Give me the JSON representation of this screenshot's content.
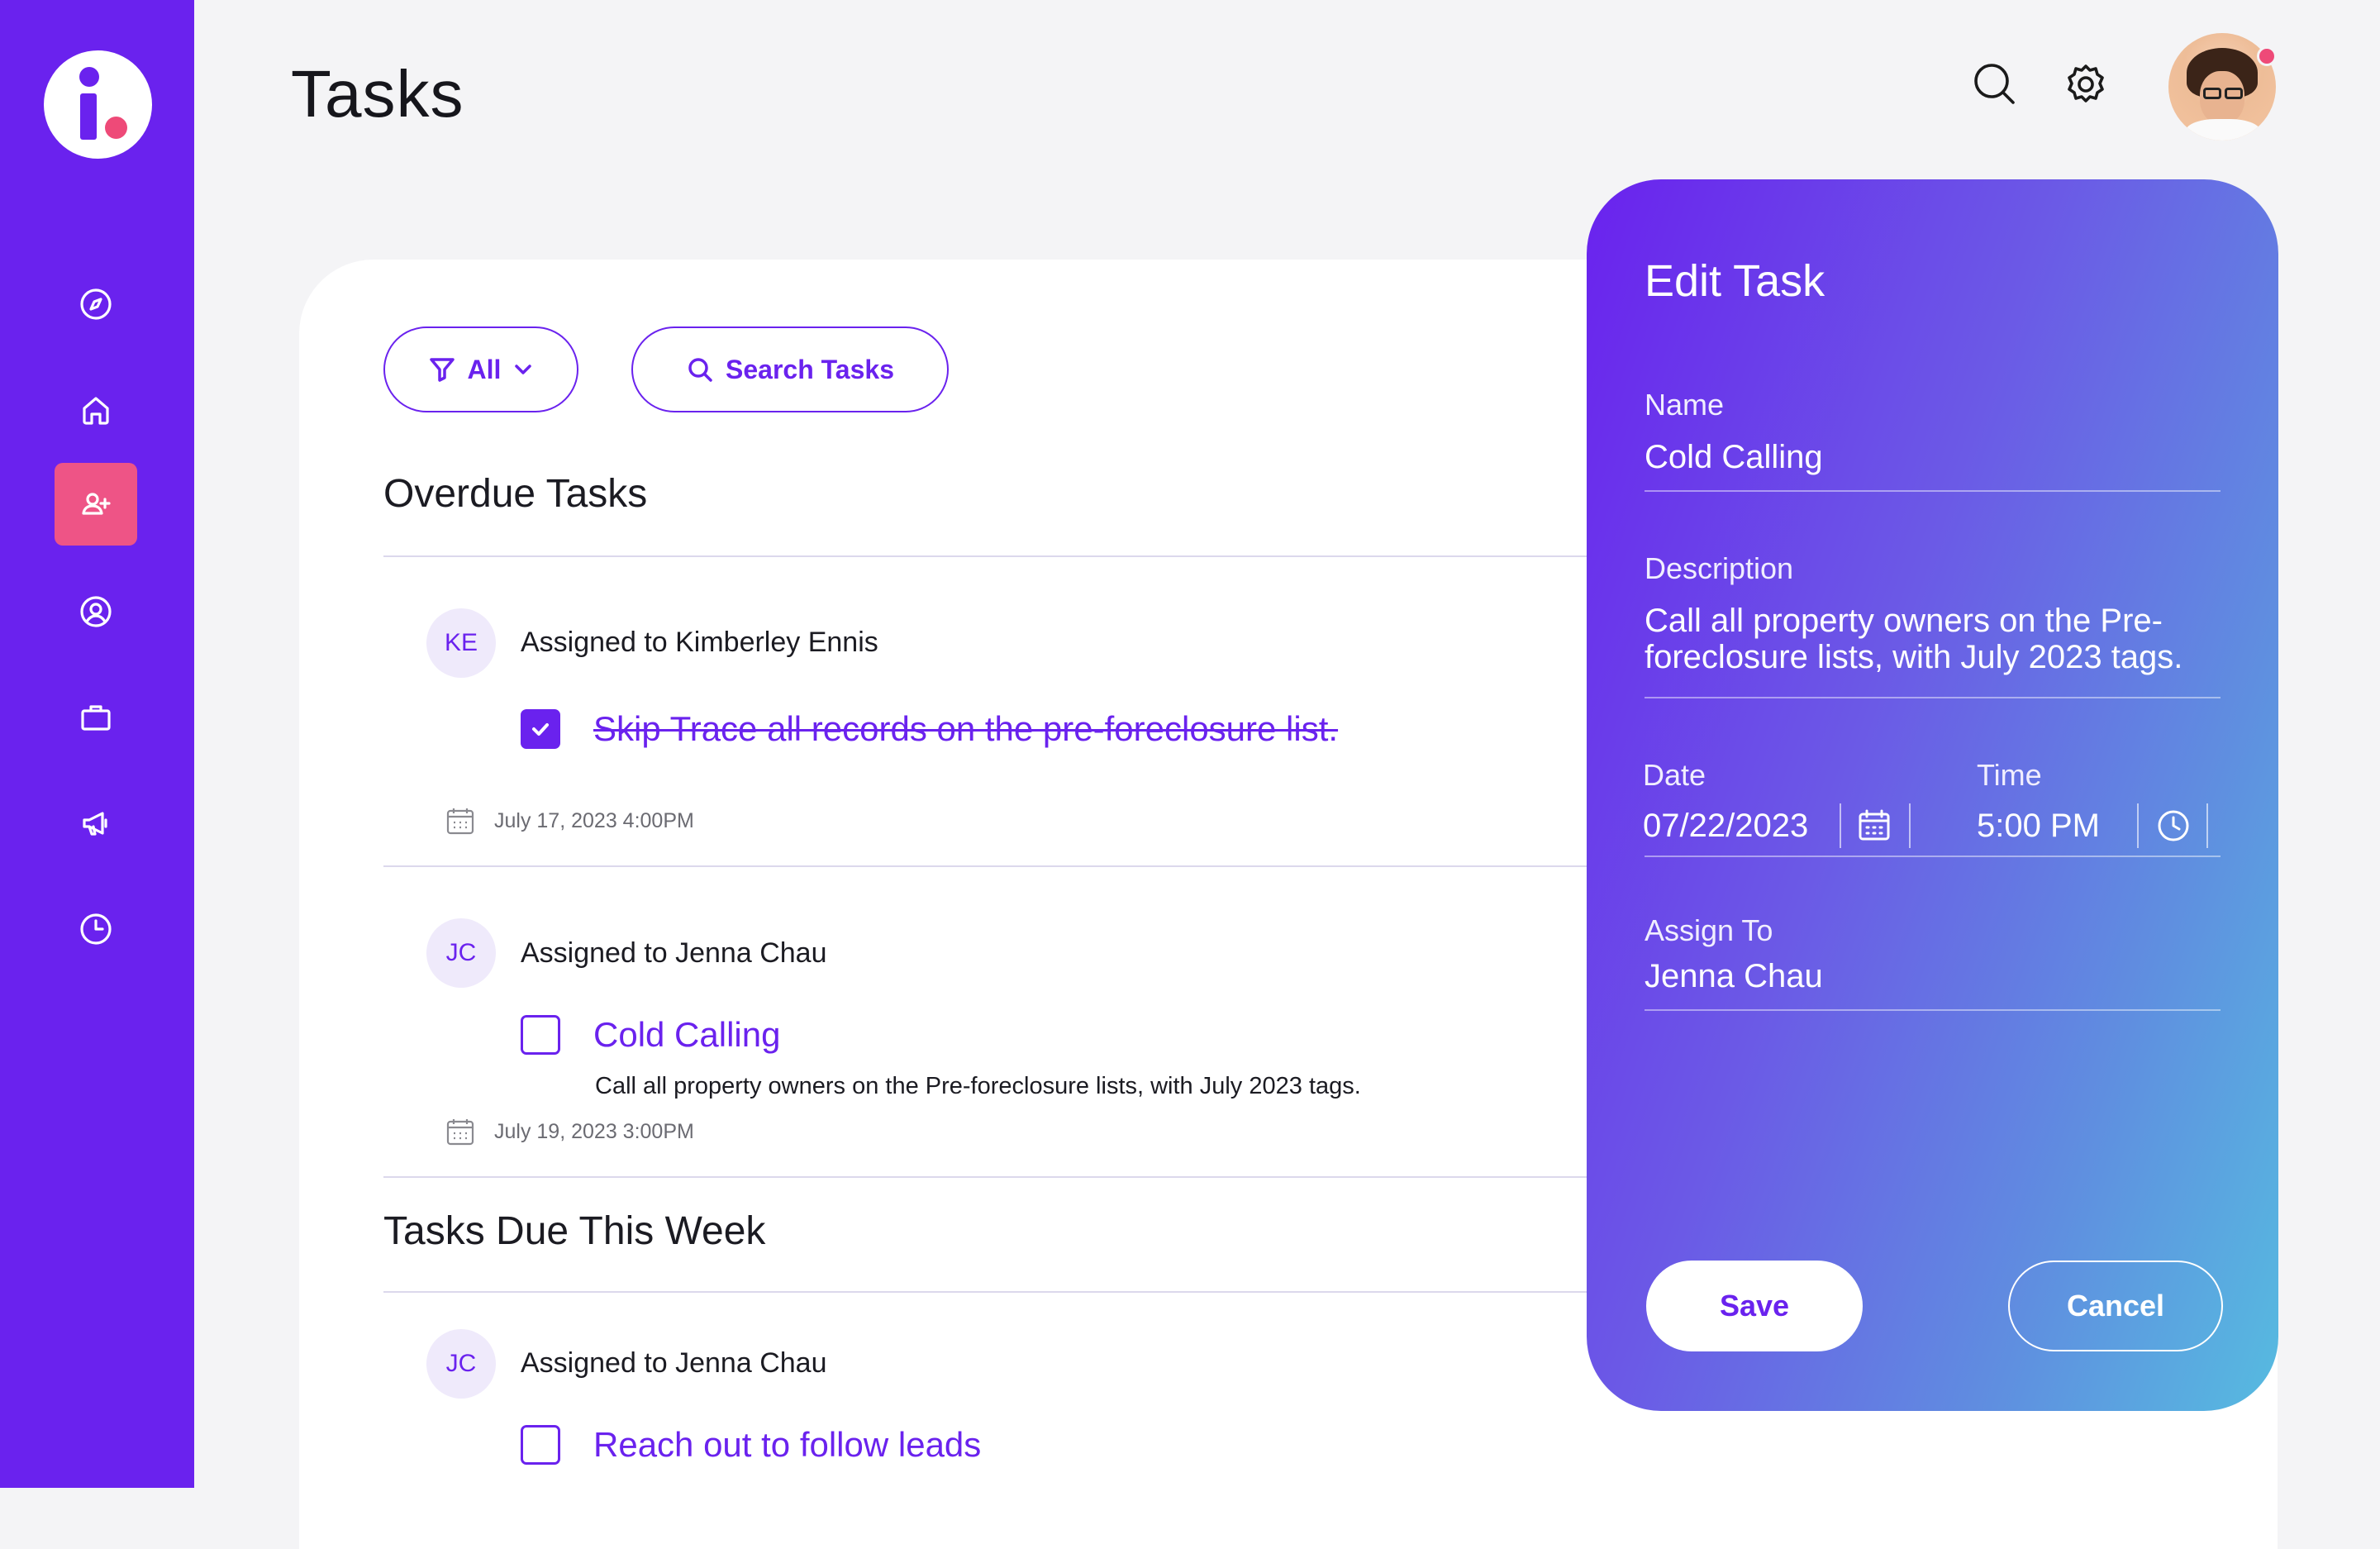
{
  "page": {
    "title": "Tasks"
  },
  "sidebar": {
    "items": [
      {
        "icon": "compass-icon",
        "active": false
      },
      {
        "icon": "home-icon",
        "active": false
      },
      {
        "icon": "add-user-icon",
        "active": true
      },
      {
        "icon": "user-circle-icon",
        "active": false
      },
      {
        "icon": "briefcase-icon",
        "active": false
      },
      {
        "icon": "megaphone-icon",
        "active": false
      },
      {
        "icon": "clock-icon",
        "active": false
      }
    ]
  },
  "header": {
    "search_icon": "search-icon",
    "settings_icon": "gear-icon"
  },
  "toolbar": {
    "filter_label": "All",
    "search_label": "Search Tasks"
  },
  "sections": {
    "overdue": {
      "title": "Overdue Tasks",
      "tasks": [
        {
          "initials": "KE",
          "assigned": "Assigned to Kimberley Ennis",
          "name": "Skip Trace all records on the pre-foreclosure list.",
          "completed": true,
          "description": "",
          "date": "July 17, 2023 4:00PM"
        },
        {
          "initials": "JC",
          "assigned": "Assigned to Jenna Chau",
          "name": "Cold Calling",
          "completed": false,
          "description": "Call all property owners on the Pre-foreclosure lists, with July 2023 tags.",
          "date": "July 19, 2023 3:00PM"
        }
      ]
    },
    "this_week": {
      "title": "Tasks Due This Week",
      "tasks": [
        {
          "initials": "JC",
          "assigned": "Assigned to Jenna Chau",
          "name": "Reach out to follow leads",
          "completed": false
        }
      ]
    }
  },
  "edit_panel": {
    "title": "Edit Task",
    "name_label": "Name",
    "name_value": "Cold Calling",
    "description_label": "Description",
    "description_line1": "Call all property owners on the Pre-",
    "description_line2": "foreclosure lists, with July 2023 tags.",
    "date_label": "Date",
    "date_value": "07/22/2023",
    "time_label": "Time",
    "time_value": "5:00 PM",
    "assign_label": "Assign To",
    "assign_value": "Jenna Chau",
    "save_label": "Save",
    "cancel_label": "Cancel"
  },
  "colors": {
    "accent": "#6a22ee",
    "active_nav": "#ee5486",
    "notification": "#ee4a78"
  }
}
